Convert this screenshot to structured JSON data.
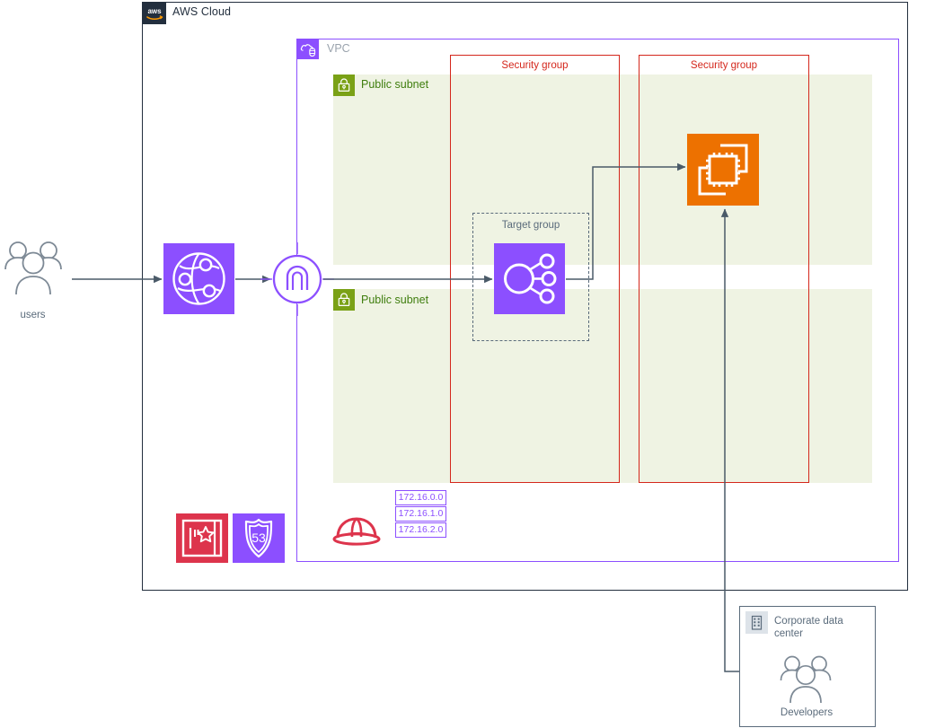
{
  "diagram": {
    "title_visible": false,
    "type": "aws-architecture-diagram",
    "colors": {
      "aws_cloud_border": "#232f3e",
      "vpc_purple": "#8c4fff",
      "subnet_green_fill": "#eff3e3",
      "subnet_green_badge": "#7aa116",
      "subnet_label_green": "#3f7e0e",
      "security_group_red": "#d4271c",
      "ec2_orange": "#ed7100",
      "acm_red": "#dd344c",
      "actor_gray": "#5a6b7b",
      "vpc_label_gray": "#9aa3ad"
    }
  },
  "aws_cloud": {
    "label": "AWS Cloud",
    "icon": "aws-logo-icon"
  },
  "vpc": {
    "label": "VPC",
    "icon": "vpc-cloud-icon"
  },
  "subnets": [
    {
      "label": "Public subnet",
      "icon": "lock-icon"
    },
    {
      "label": "Public subnet",
      "icon": "lock-icon"
    }
  ],
  "security_groups": [
    {
      "label": "Security group"
    },
    {
      "label": "Security group"
    }
  ],
  "target_group": {
    "label": "Target group"
  },
  "resources": {
    "cloudfront": {
      "icon": "cloudfront-globe-icon",
      "label": ""
    },
    "internet_gateway": {
      "icon": "internet-gateway-icon",
      "label": ""
    },
    "elastic_load_balancing_target": {
      "icon": "target-group-nodes-icon",
      "label": ""
    },
    "ec2_instance": {
      "icon": "ec2-instance-icon",
      "label": ""
    },
    "certificate_manager": {
      "icon": "certificate-manager-icon",
      "label": ""
    },
    "route53": {
      "icon": "route-53-icon",
      "label": "53"
    },
    "hard_hat": {
      "icon": "hard-hat-icon",
      "label": ""
    }
  },
  "actors": {
    "users": {
      "label": "users",
      "icon": "users-group-icon"
    },
    "developers": {
      "label": "Developers",
      "icon": "users-group-icon"
    }
  },
  "corporate_data_center": {
    "label": "Corporate data center",
    "icon": "corporate-building-icon"
  },
  "cidr_blocks": [
    "172.16.0.0",
    "172.16.1.0",
    "172.16.2.0"
  ]
}
